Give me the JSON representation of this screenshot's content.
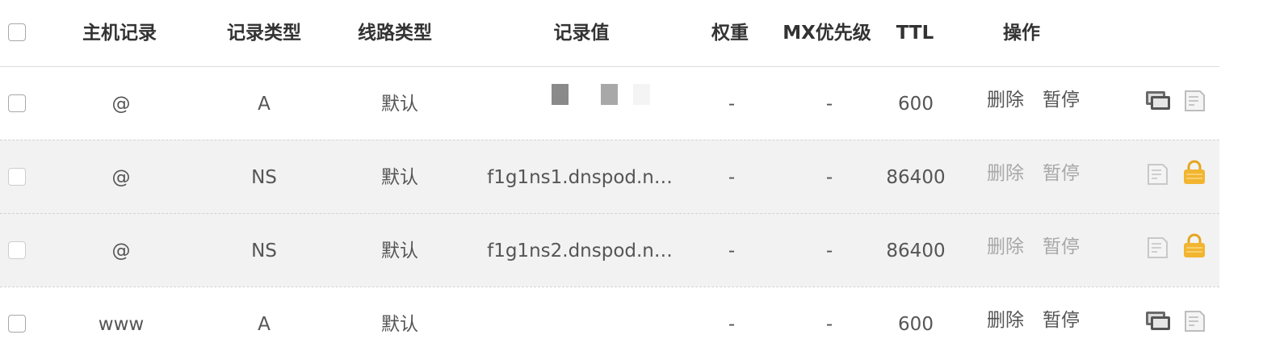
{
  "header": {
    "columns": [
      "主机记录",
      "记录类型",
      "线路类型",
      "记录值",
      "权重",
      "MX优先级",
      "TTL",
      "操作"
    ]
  },
  "rows": [
    {
      "host": "@",
      "type": "A",
      "line": "默认",
      "value": "",
      "weight": "-",
      "mx": "-",
      "ttl": "600",
      "delete_label": "删除",
      "pause_label": "暂停",
      "enabled": true,
      "icons": [
        "remark-icon",
        "note-icon"
      ]
    },
    {
      "host": "@",
      "type": "NS",
      "line": "默认",
      "value": "f1g1ns1.dnspod.n…",
      "weight": "-",
      "mx": "-",
      "ttl": "86400",
      "delete_label": "删除",
      "pause_label": "暂停",
      "enabled": false,
      "icons": [
        "note-icon",
        "lock-icon"
      ]
    },
    {
      "host": "@",
      "type": "NS",
      "line": "默认",
      "value": "f1g1ns2.dnspod.n…",
      "weight": "-",
      "mx": "-",
      "ttl": "86400",
      "delete_label": "删除",
      "pause_label": "暂停",
      "enabled": false,
      "icons": [
        "note-icon",
        "lock-icon"
      ]
    },
    {
      "host": "www",
      "type": "A",
      "line": "默认",
      "value": "",
      "weight": "-",
      "mx": "-",
      "ttl": "600",
      "delete_label": "删除",
      "pause_label": "暂停",
      "enabled": true,
      "icons": [
        "remark-icon",
        "note-icon"
      ]
    }
  ],
  "colors": {
    "link": "#2f6eb8",
    "disabled": "#a8a8a8",
    "lock": "#f2b530",
    "row_alt": "#f2f2f2"
  }
}
